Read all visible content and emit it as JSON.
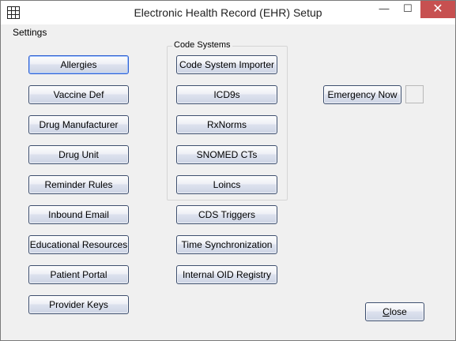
{
  "window": {
    "title": "Electronic Health Record (EHR) Setup",
    "close_glyph": "✕",
    "min_glyph": "—",
    "max_glyph": "☐",
    "icon": "grid-icon"
  },
  "menu": {
    "settings": "Settings"
  },
  "left_buttons": [
    "Allergies",
    "Vaccine Def",
    "Drug Manufacturer",
    "Drug Unit",
    "Reminder Rules",
    "Inbound Email",
    "Educational Resources",
    "Patient Portal",
    "Provider Keys"
  ],
  "code_systems": {
    "label": "Code Systems",
    "buttons": [
      "Code System Importer",
      "ICD9s",
      "RxNorms",
      "SNOMED CTs",
      "Loincs"
    ]
  },
  "middle_buttons": [
    "CDS Triggers",
    "Time Synchronization",
    "Internal OID Registry"
  ],
  "emergency_now": "Emergency Now",
  "close_button": {
    "mnemonic": "C",
    "rest": "lose"
  },
  "colors": {
    "close_button_red": "#c75050",
    "button_border": "#3c4e6e",
    "background": "#f0f0f0"
  }
}
